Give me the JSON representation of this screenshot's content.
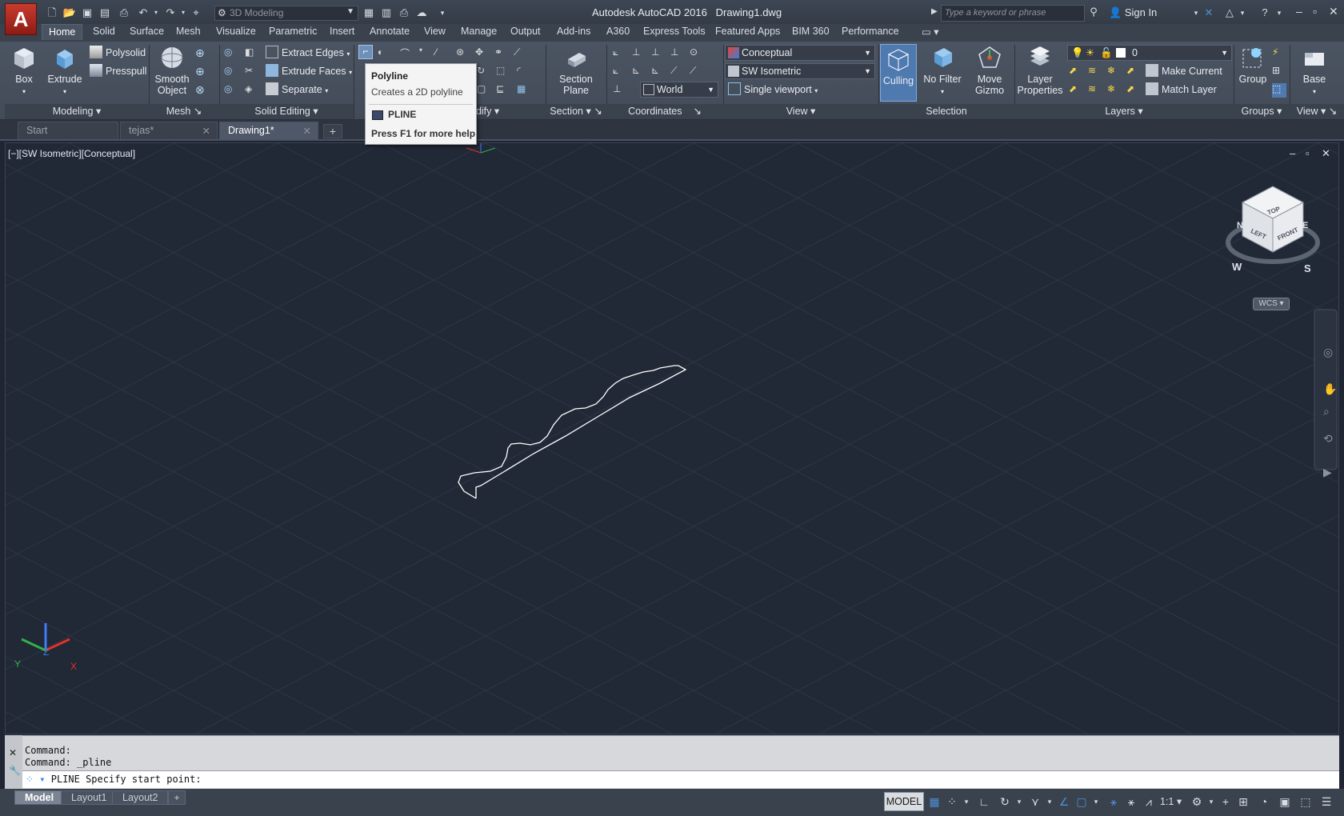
{
  "app": {
    "title": "Autodesk AutoCAD 2016",
    "filename": "Drawing1.dwg",
    "workspace": "3D Modeling",
    "search_placeholder": "Type a keyword or phrase",
    "sign_in": "Sign In"
  },
  "ribbon_tabs": [
    "Home",
    "Solid",
    "Surface",
    "Mesh",
    "Visualize",
    "Parametric",
    "Insert",
    "Annotate",
    "View",
    "Manage",
    "Output",
    "Add-ins",
    "A360",
    "Express Tools",
    "Featured Apps",
    "BIM 360",
    "Performance"
  ],
  "ribbon": {
    "modeling": {
      "box": "Box",
      "extrude": "Extrude",
      "polysolid": "Polysolid",
      "presspull": "Presspull",
      "footer": "Modeling"
    },
    "mesh": {
      "smooth": "Smooth",
      "object": "Object",
      "footer": "Mesh"
    },
    "solid_editing": {
      "extract_edges": "Extract Edges",
      "extrude_faces": "Extrude Faces",
      "separate": "Separate",
      "footer": "Solid Editing"
    },
    "modify": {
      "footer": "odify"
    },
    "section": {
      "section": "Section",
      "plane": "Plane",
      "footer": "Section"
    },
    "coordinates": {
      "world": "World",
      "footer": "Coordinates"
    },
    "view": {
      "visual_style": "Conceptual",
      "view_preset": "SW Isometric",
      "viewport": "Single viewport",
      "footer": "View"
    },
    "selection": {
      "culling": "Culling",
      "no_filter": "No Filter",
      "move": "Move",
      "gizmo": "Gizmo",
      "footer": "Selection"
    },
    "layers": {
      "layer": "Layer",
      "properties": "Properties",
      "current_layer": "0",
      "make_current": "Make Current",
      "match_layer": "Match Layer",
      "footer": "Layers"
    },
    "groups": {
      "group": "Group",
      "footer": "Groups"
    },
    "view_panel": {
      "base": "Base",
      "footer": "View"
    }
  },
  "doc_tabs": [
    {
      "label": "Start",
      "active": false
    },
    {
      "label": "tejas*",
      "active": false
    },
    {
      "label": "Drawing1*",
      "active": true
    }
  ],
  "viewport": {
    "label": "[−][SW Isometric][Conceptual]",
    "wcs": "WCS",
    "viewcube": {
      "top": "TOP",
      "left": "LEFT",
      "front": "FRONT"
    },
    "compass": {
      "w": "W",
      "s": "S",
      "n": "N",
      "e": "E"
    },
    "ucs": {
      "x": "X",
      "y": "Y",
      "z": "Z"
    }
  },
  "tooltip": {
    "title": "Polyline",
    "description": "Creates a 2D polyline",
    "command": "PLINE",
    "help": "Press F1 for more help"
  },
  "command_line": {
    "history": [
      "Command:",
      "Command: _pline"
    ],
    "prompt": "PLINE Specify start point:"
  },
  "layout_tabs": [
    "Model",
    "Layout1",
    "Layout2"
  ],
  "status": {
    "model": "MODEL",
    "scale": "1:1"
  },
  "colors": {
    "viewport_bg": "#212836",
    "grid": "#323a48",
    "accent": "#4f8fd8",
    "brand": "#c83b2f"
  }
}
